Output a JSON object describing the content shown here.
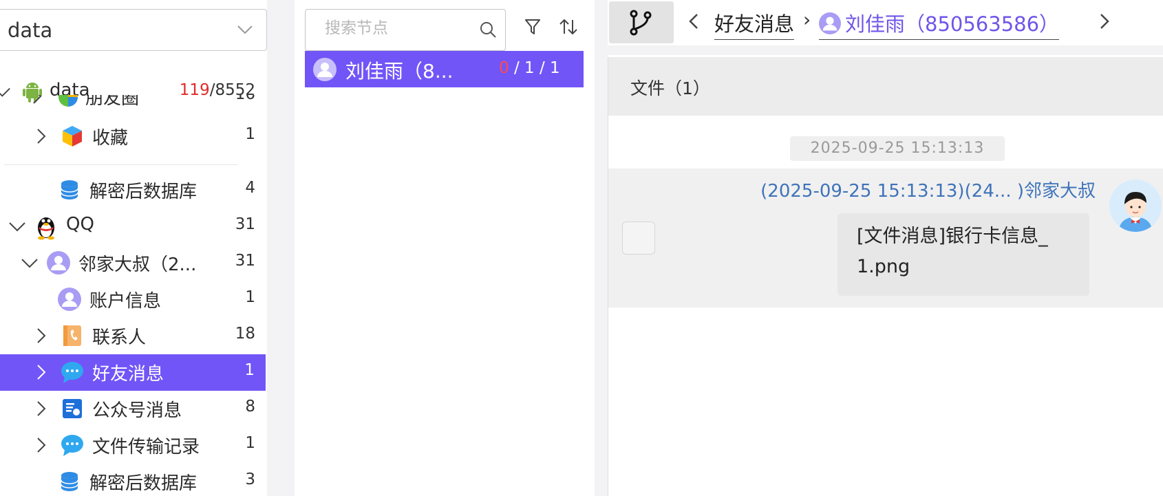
{
  "left": {
    "root_select": "data",
    "tree": [
      {
        "label": "data",
        "count_red": "119",
        "count_rest": "/8552",
        "icon": "android-icon"
      },
      {
        "label": "朋友圈",
        "count": "16",
        "icon": "moments-icon"
      },
      {
        "label": "收藏",
        "count": "1",
        "icon": "favorites-icon"
      },
      {
        "label": "解密后数据库",
        "count": "4",
        "icon": "database-icon"
      },
      {
        "label": "QQ",
        "count": "31",
        "icon": "qq-penguin-icon"
      },
      {
        "label": "邻家大叔（2...",
        "count": "31",
        "icon": "user-avatar-icon"
      },
      {
        "label": "账户信息",
        "count": "1",
        "icon": "user-avatar-icon"
      },
      {
        "label": "联系人",
        "count": "18",
        "icon": "contacts-book-icon"
      },
      {
        "label": "好友消息",
        "count": "1",
        "icon": "chat-bubble-icon"
      },
      {
        "label": "公众号消息",
        "count": "8",
        "icon": "official-account-icon"
      },
      {
        "label": "文件传输记录",
        "count": "1",
        "icon": "chat-bubble-icon"
      },
      {
        "label": "解密后数据库",
        "count": "3",
        "icon": "database-icon"
      }
    ]
  },
  "mid": {
    "search_placeholder": "搜索节点",
    "node": {
      "name": "刘佳雨（8...",
      "zero": "0",
      "rest": " / 1 / 1"
    }
  },
  "right": {
    "breadcrumb": {
      "parent": "好友消息",
      "separator": "›",
      "current": "刘佳雨（850563586）"
    },
    "file_header": "文件（1）",
    "timestamp": "2025-09-25 15:13:13",
    "message": {
      "sender": "(2025-09-25 15:13:13)(24... )邻家大叔",
      "line1": "[文件消息]银行卡信息_",
      "line2": "1.png"
    }
  },
  "colors": {
    "accent": "#7255f7",
    "link": "#3e73b9",
    "red": "#e02a2a"
  }
}
